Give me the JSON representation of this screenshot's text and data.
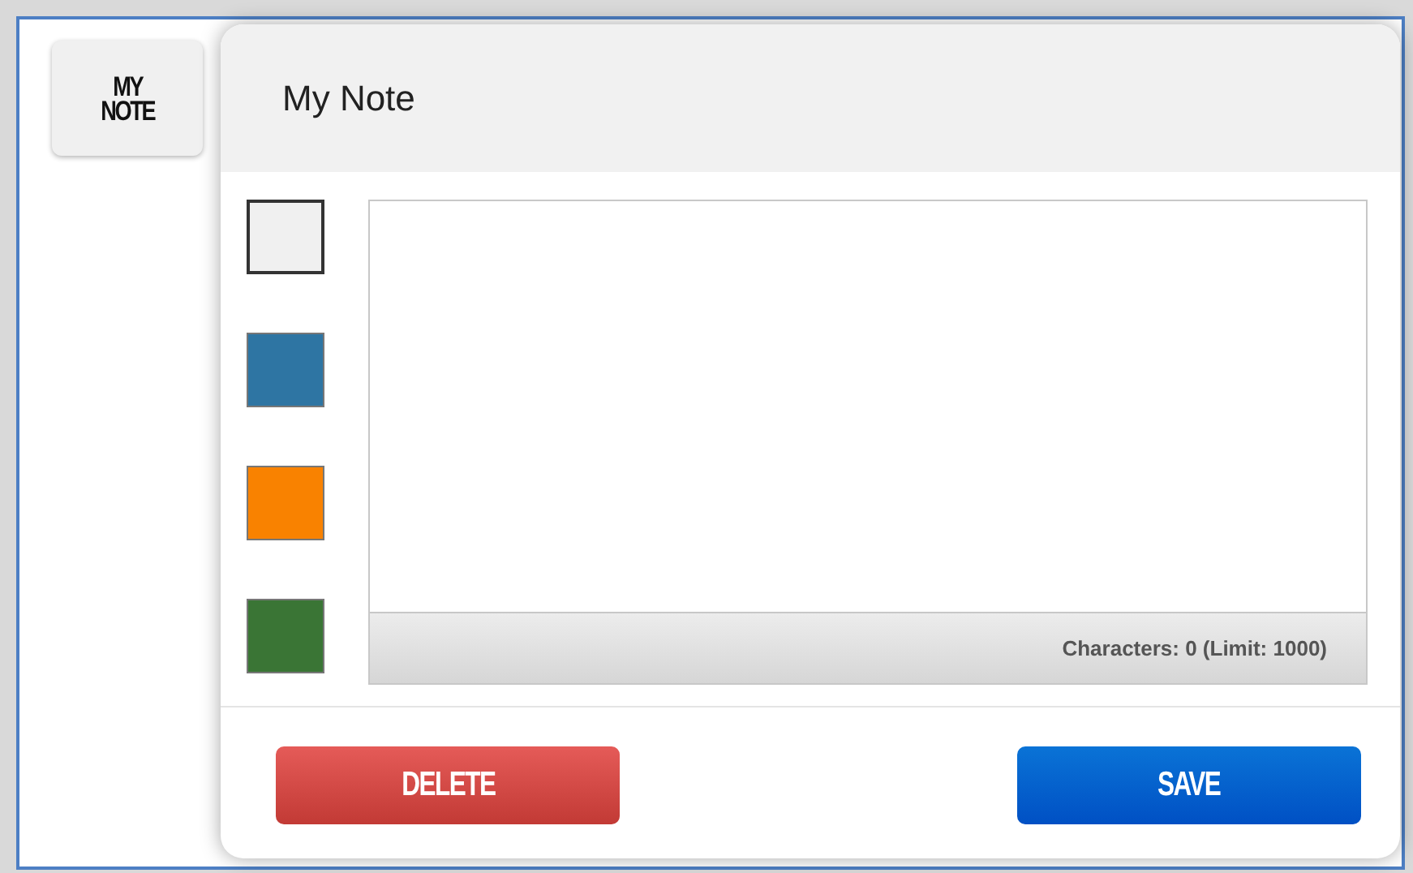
{
  "side_tab": {
    "label_lines": [
      "MY",
      "NOTE"
    ]
  },
  "dialog": {
    "title": "My Note",
    "swatches": [
      {
        "color": "#f0f0f0",
        "selected": true
      },
      {
        "color": "#2e75a3",
        "selected": false
      },
      {
        "color": "#f98200",
        "selected": false
      },
      {
        "color": "#3a7535",
        "selected": false
      }
    ],
    "counter": "Characters: 0 (Limit: 1000)",
    "buttons": [
      {
        "label": "DELETE",
        "kind": "danger"
      },
      {
        "label": "SAVE",
        "kind": "primary"
      }
    ]
  }
}
